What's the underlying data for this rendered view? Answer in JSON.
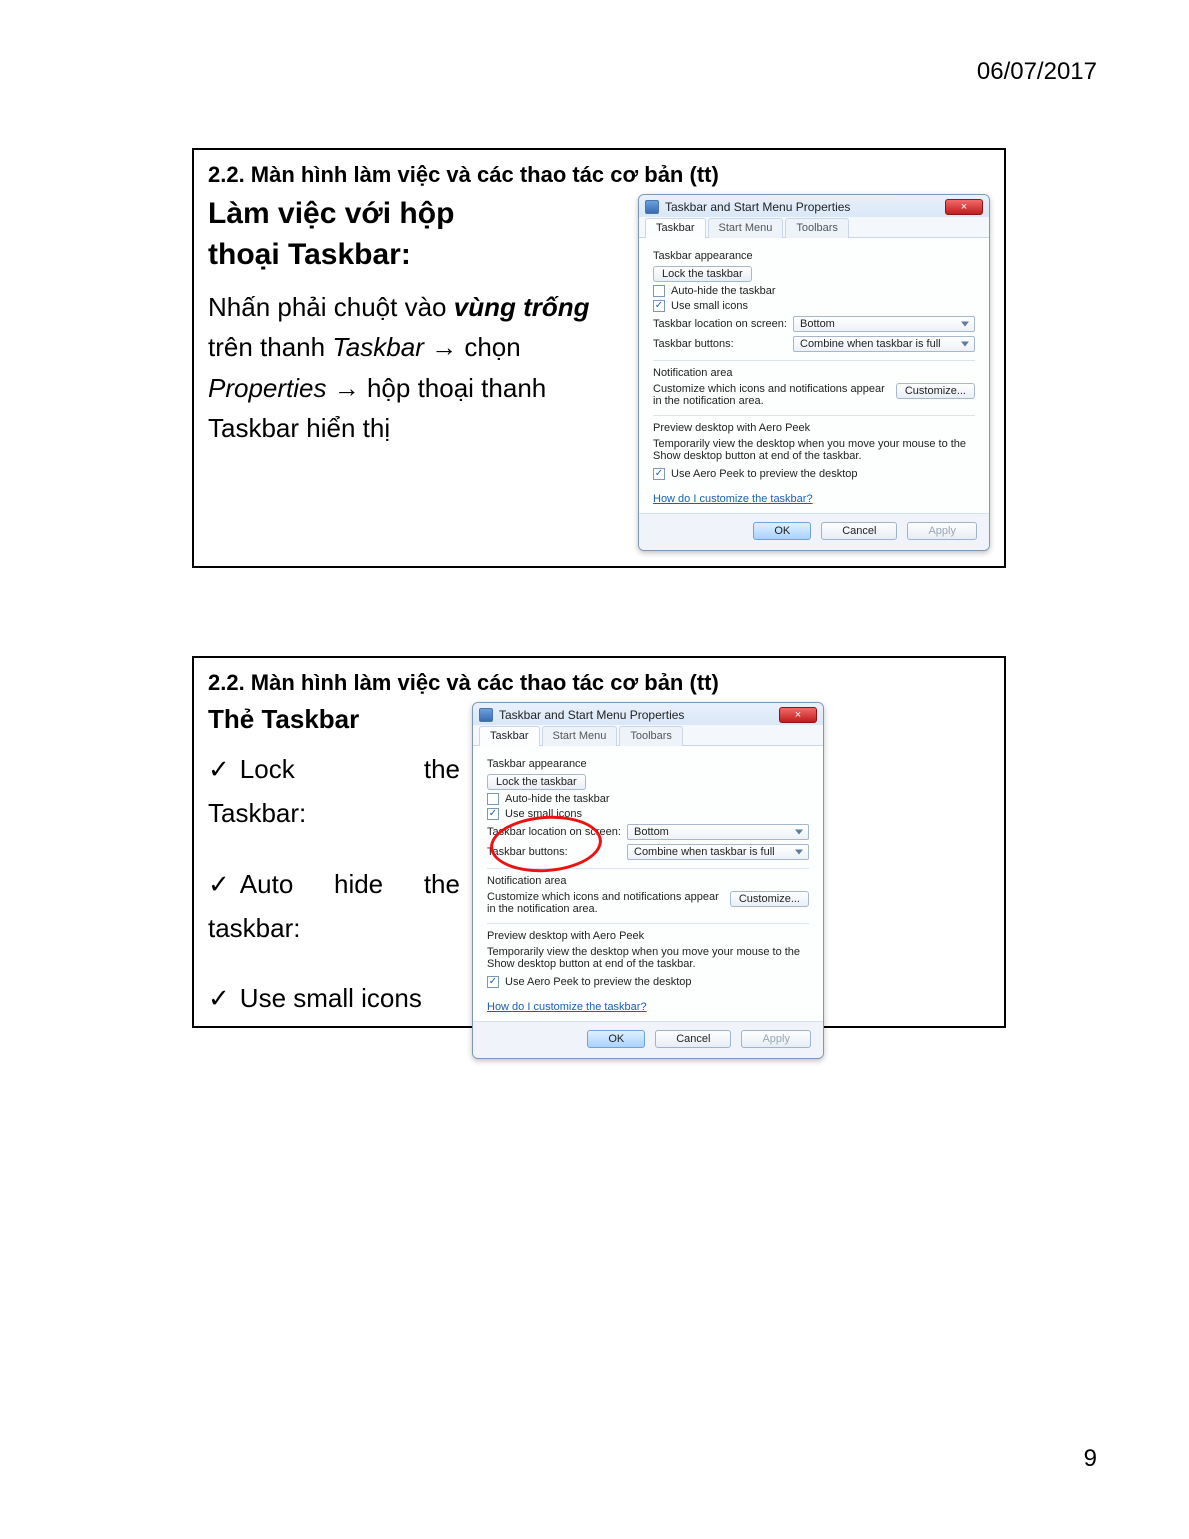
{
  "page": {
    "date": "06/07/2017",
    "number": "9"
  },
  "slide1": {
    "headline": "2.2. Màn hình làm việc và các thao tác cơ bản (tt)",
    "subtitle_line1": "Làm việc với hộp",
    "subtitle_line2": "thoại Taskbar:",
    "body_pre": "Nhấn phải chuột vào ",
    "body_bold_italic": "vùng trống",
    "body_mid1": " trên thanh ",
    "body_italic1": "Taskbar",
    "body_arrow": " → ",
    "body_mid2": "chọn ",
    "body_italic2": "Properties",
    "body_tail": "hộp thoại thanh Taskbar hiển thị"
  },
  "slide2": {
    "headline": "2.2. Màn hình làm việc và các thao tác cơ bản (tt)",
    "subtitle": "Thẻ Taskbar",
    "bullet1a": "Lock",
    "bullet1b": "the",
    "bullet1_tail": "Taskbar:",
    "bullet2a": "Auto",
    "bullet2b": "hide",
    "bullet2c": "the",
    "bullet2_tail": "taskbar:",
    "bullet3": "Use small icons"
  },
  "dialog": {
    "title": "Taskbar and Start Menu Properties",
    "close_x": "×",
    "tabs": {
      "taskbar": "Taskbar",
      "startmenu": "Start Menu",
      "toolbars": "Toolbars"
    },
    "appearance_label": "Taskbar appearance",
    "lock_btn": "Lock the taskbar",
    "autohide_label": "Auto-hide the taskbar",
    "smallicons_label": "Use small icons",
    "location_label": "Taskbar location on screen:",
    "location_value": "Bottom",
    "buttons_label": "Taskbar buttons:",
    "buttons_value": "Combine when taskbar is full",
    "notif_header": "Notification area",
    "notif_text": "Customize which icons and notifications appear in the notification area.",
    "customize_btn": "Customize...",
    "peek_header": "Preview desktop with Aero Peek",
    "peek_text": "Temporarily view the desktop when you move your mouse to the Show desktop button at end of the taskbar.",
    "peek_checkbox": "Use Aero Peek to preview the desktop",
    "help_link": "How do I customize the taskbar?",
    "ok": "OK",
    "cancel": "Cancel",
    "apply": "Apply",
    "check_mark": "✓"
  }
}
